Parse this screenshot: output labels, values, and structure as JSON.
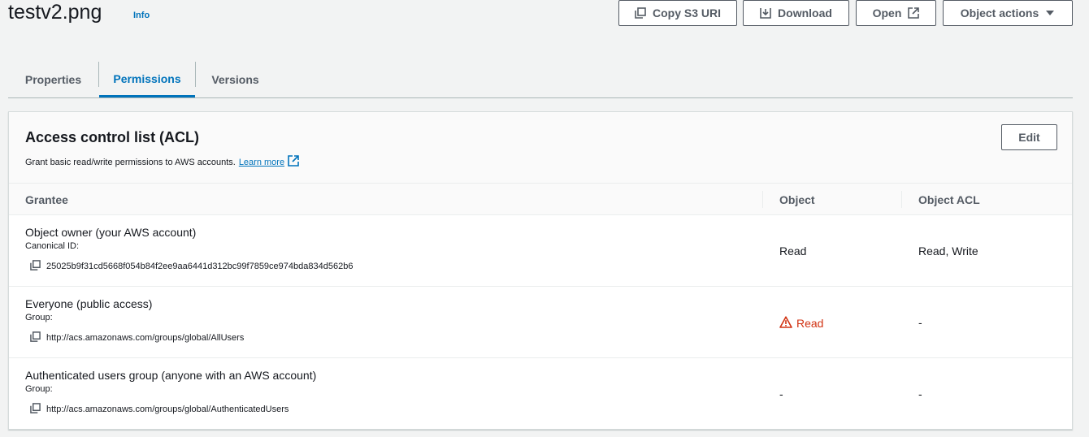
{
  "header": {
    "title": "testv2.png",
    "info_label": "Info",
    "buttons": {
      "copy_s3_uri": "Copy S3 URI",
      "download": "Download",
      "open": "Open",
      "object_actions": "Object actions"
    }
  },
  "tabs": [
    {
      "label": "Properties",
      "active": false
    },
    {
      "label": "Permissions",
      "active": true
    },
    {
      "label": "Versions",
      "active": false
    }
  ],
  "acl": {
    "title": "Access control list (ACL)",
    "description": "Grant basic read/write permissions to AWS accounts.",
    "learn_more": "Learn more",
    "edit_label": "Edit",
    "columns": {
      "grantee": "Grantee",
      "object": "Object",
      "object_acl": "Object ACL"
    },
    "rows": [
      {
        "grantee": "Object owner (your AWS account)",
        "id_label": "Canonical ID:",
        "id_value": "25025b9f31cd5668f054b84f2ee9aa6441d312bc99f7859ce974bda834d562b6",
        "object": "Read",
        "object_acl": "Read, Write",
        "warning": false
      },
      {
        "grantee": "Everyone (public access)",
        "id_label": "Group:",
        "id_value": "http://acs.amazonaws.com/groups/global/AllUsers",
        "object": "Read",
        "object_acl": "-",
        "warning": true
      },
      {
        "grantee": "Authenticated users group (anyone with an AWS account)",
        "id_label": "Group:",
        "id_value": "http://acs.amazonaws.com/groups/global/AuthenticatedUsers",
        "object": "-",
        "object_acl": "-",
        "warning": false
      }
    ]
  },
  "colors": {
    "accent": "#0073bb",
    "warning": "#d13212",
    "button_border": "#545b64",
    "page_bg": "#f2f3f3"
  },
  "icons": {
    "copy": "copy-icon",
    "download": "download-icon",
    "external": "external-link-icon",
    "dropdown": "caret-down-icon",
    "warning": "warning-icon"
  }
}
